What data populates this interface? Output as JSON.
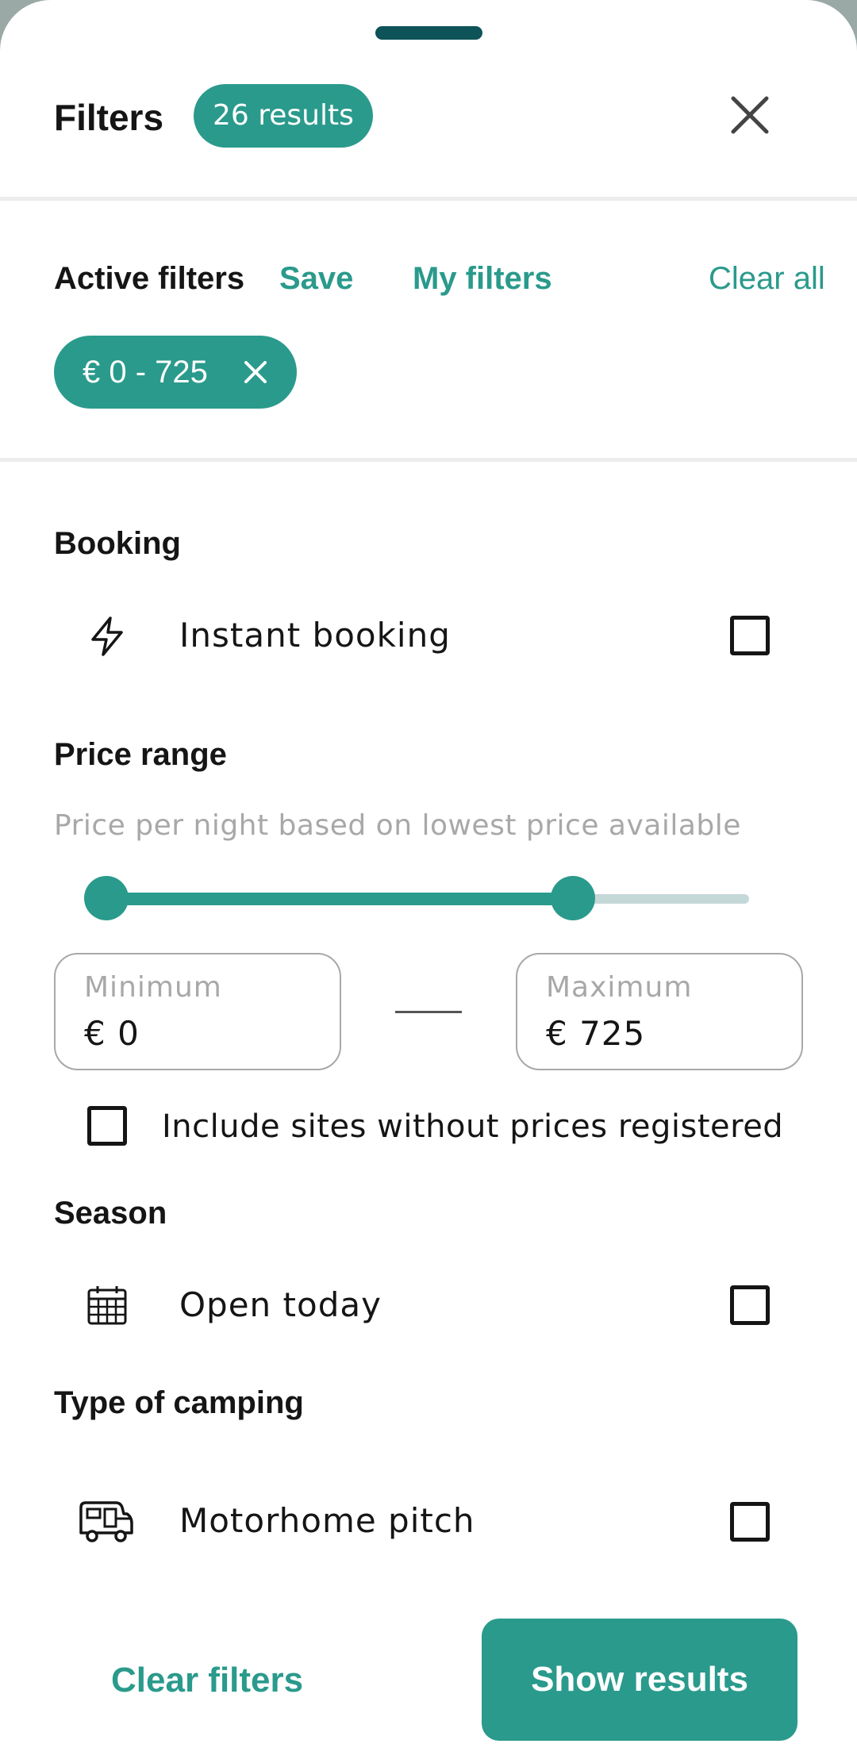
{
  "header": {
    "title": "Filters",
    "results_badge": "26 results"
  },
  "active_filters": {
    "label": "Active filters",
    "save_label": "Save",
    "my_filters_label": "My filters",
    "clear_all_label": "Clear all",
    "chips": [
      {
        "label": "€ 0 - 725"
      }
    ]
  },
  "booking": {
    "title": "Booking",
    "instant_booking_label": "Instant booking",
    "instant_booking_icon": "lightning-icon",
    "instant_booking_checked": false
  },
  "price_range": {
    "title": "Price range",
    "hint": "Price per night based on lowest price available",
    "minimum_caption": "Minimum",
    "minimum_value": "€ 0",
    "maximum_caption": "Maximum",
    "maximum_value": "€ 725",
    "slider_min_fraction": 0,
    "slider_max_fraction": 0.72,
    "include_unpriced_label": "Include sites without prices registered",
    "include_unpriced_checked": false
  },
  "season": {
    "title": "Season",
    "open_today_label": "Open today",
    "open_today_icon": "calendar-icon",
    "open_today_checked": false
  },
  "camping_type": {
    "title": "Type of camping",
    "motorhome_label": "Motorhome pitch",
    "motorhome_icon": "motorhome-icon",
    "motorhome_checked": false
  },
  "footer": {
    "clear_filters_label": "Clear filters",
    "show_results_label": "Show results"
  },
  "colors": {
    "accent": "#2a9a8c",
    "handle": "#0d5358"
  }
}
